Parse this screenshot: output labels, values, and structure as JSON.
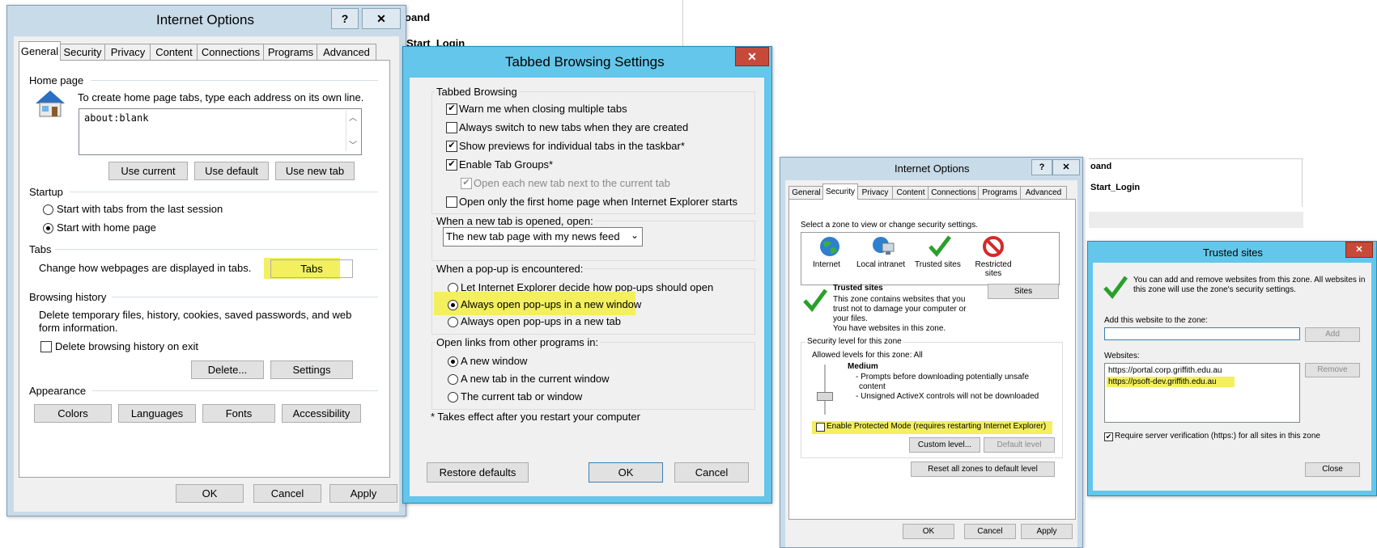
{
  "background": {
    "text_a": "oand",
    "text_b": "Start_Login",
    "text_c": "oand",
    "text_d": "Start_Login"
  },
  "io1": {
    "title": "Internet Options",
    "help": "?",
    "close": "✕",
    "tabs": [
      "General",
      "Security",
      "Privacy",
      "Content",
      "Connections",
      "Programs",
      "Advanced"
    ],
    "home_page_header": "Home page",
    "home_page_desc": "To create home page tabs, type each address on its own line.",
    "home_page_value": "about:blank",
    "use_current": "Use current",
    "use_default": "Use default",
    "use_new_tab": "Use new tab",
    "startup_header": "Startup",
    "startup_opt1": "Start with tabs from the last session",
    "startup_opt2": "Start with home page",
    "tabs_header": "Tabs",
    "tabs_desc": "Change how webpages are displayed in tabs.",
    "tabs_button": "Tabs",
    "history_header": "Browsing history",
    "history_desc1": "Delete temporary files, history, cookies, saved passwords, and web",
    "history_desc2": "form information.",
    "delete_on_exit": "Delete browsing history on exit",
    "delete_btn": "Delete...",
    "settings_btn": "Settings",
    "appearance_header": "Appearance",
    "colors": "Colors",
    "languages": "Languages",
    "fonts": "Fonts",
    "accessibility": "Accessibility",
    "ok": "OK",
    "cancel": "Cancel",
    "apply": "Apply"
  },
  "tbs": {
    "title": "Tabbed Browsing Settings",
    "close": "✕",
    "group1": "Tabbed Browsing",
    "cb1": "Warn me when closing multiple tabs",
    "cb2": "Always switch to new tabs when they are created",
    "cb3": "Show previews for individual tabs in the taskbar*",
    "cb4": "Enable Tab Groups*",
    "cb5": "Open each new tab next to the current tab",
    "cb6": "Open only the first home page when Internet Explorer starts",
    "group2": "When a new tab is opened, open:",
    "select_value": "The new tab page with my news feed",
    "group3": "When a pop-up is encountered:",
    "popup1": "Let Internet Explorer decide how pop-ups should open",
    "popup2": "Always open pop-ups in a new window",
    "popup3": "Always open pop-ups in a new tab",
    "group4": "Open links from other programs in:",
    "link1": "A new window",
    "link2": "A new tab in the current window",
    "link3": "The current tab or window",
    "footnote": "* Takes effect after you restart your computer",
    "restore": "Restore defaults",
    "ok": "OK",
    "cancel": "Cancel"
  },
  "io2": {
    "title": "Internet Options",
    "help": "?",
    "close": "✕",
    "tabs": [
      "General",
      "Security",
      "Privacy",
      "Content",
      "Connections",
      "Programs",
      "Advanced"
    ],
    "zone_prompt": "Select a zone to view or change security settings.",
    "zones": [
      "Internet",
      "Local intranet",
      "Trusted sites",
      "Restricted sites"
    ],
    "zone_title": "Trusted sites",
    "zone_desc1": "This zone contains websites that you",
    "zone_desc2": "trust not to damage your computer or",
    "zone_desc3": "your files.",
    "zone_desc4": "You have websites in this zone.",
    "sites_btn": "Sites",
    "level_header": "Security level for this zone",
    "allowed": "Allowed levels for this zone: All",
    "level_name": "Medium",
    "level_b1": "- Prompts before downloading potentially unsafe",
    "level_b1b": "content",
    "level_b2": "- Unsigned ActiveX controls will not be downloaded",
    "protected_mode": "Enable Protected Mode (requires restarting Internet Explorer)",
    "custom_btn": "Custom level...",
    "default_btn": "Default level",
    "reset_btn": "Reset all zones to default level",
    "ok": "OK",
    "cancel": "Cancel",
    "apply": "Apply"
  },
  "ts": {
    "title": "Trusted sites",
    "close": "✕",
    "desc1": "You can add and remove websites from this zone. All websites in",
    "desc2": "this zone will use the zone's security settings.",
    "add_label": "Add this website to the zone:",
    "add_value": "",
    "add_btn": "Add",
    "websites_label": "Websites:",
    "sites": [
      "https://portal.corp.griffith.edu.au",
      "https://psoft-dev.griffith.edu.au"
    ],
    "remove_btn": "Remove",
    "require_label": "Require server verification (https:) for all sites in this zone",
    "close_btn": "Close"
  }
}
